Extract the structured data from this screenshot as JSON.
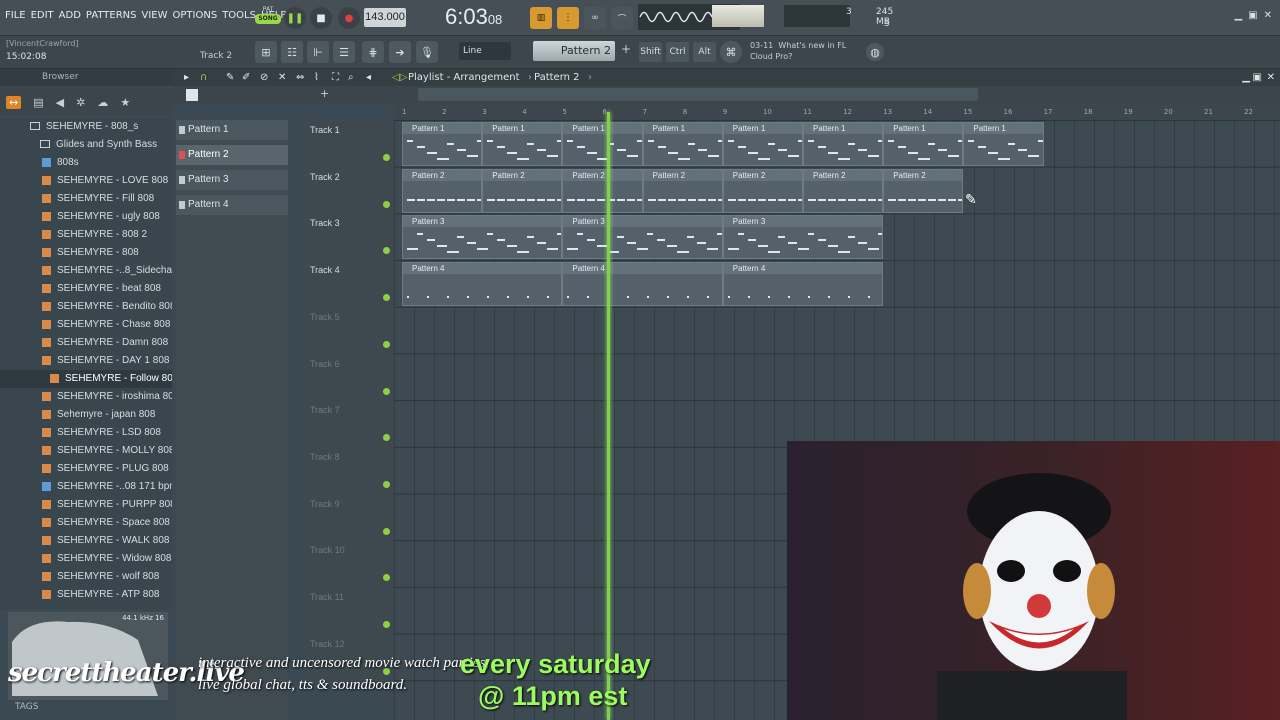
{
  "menu": [
    "FILE",
    "EDIT",
    "ADD",
    "PATTERNS",
    "VIEW",
    "OPTIONS",
    "TOOLS",
    "HELP"
  ],
  "transport": {
    "pat_label": "PAT",
    "song_label": "SONG",
    "tempo": "143.000",
    "time_main": "6:03",
    "time_sub": "08",
    "mem": "245 MB",
    "cpu_voices": "3",
    "poly": "5",
    "rec_icon": "record-icon",
    "play_icon": "pause-icon",
    "stop_icon": "stop-icon"
  },
  "toolbar2": {
    "hint_user": "[VincentCrawford]",
    "hint_time": "15:02:08",
    "hint_track": "Track 2",
    "snap": "Line",
    "pattern_selector": "Pattern 2",
    "shift": "Shift",
    "ctrl": "Ctrl",
    "alt": "Alt",
    "news_date": "03-11",
    "news_line1": "What's new in FL",
    "news_line2": "Cloud Pro?"
  },
  "browser": {
    "title": "Browser",
    "tags_label": "TAGS",
    "preview_info": "44.1 kHz 16",
    "items": [
      {
        "label": "SEHEMYRE - 808_s",
        "kind": "folder"
      },
      {
        "label": "Glides and Synth Bass",
        "kind": "folder"
      },
      {
        "label": "808s",
        "kind": "blue"
      },
      {
        "label": "SEHEMYRE -  LOVE 808",
        "kind": "file"
      },
      {
        "label": "SEHEMYRE - Fill 808",
        "kind": "file"
      },
      {
        "label": "SEHEMYRE - ugly 808",
        "kind": "file"
      },
      {
        "label": "SEHEMYRE - 808 2",
        "kind": "file"
      },
      {
        "label": "SEHEMYRE - 808",
        "kind": "file"
      },
      {
        "label": "SEHEMYRE -..8_Sidechain",
        "kind": "file"
      },
      {
        "label": "SEHEMYRE - beat 808",
        "kind": "file"
      },
      {
        "label": "SEHEMYRE - Bendito 808",
        "kind": "file"
      },
      {
        "label": "SEHEMYRE - Chase 808",
        "kind": "file"
      },
      {
        "label": "SEHEMYRE - Damn 808",
        "kind": "file"
      },
      {
        "label": "SEHEMYRE - DAY 1 808",
        "kind": "file"
      },
      {
        "label": "SEHEMYRE - Follow 808",
        "kind": "file",
        "selected": true
      },
      {
        "label": "SEHEMYRE - iroshima 808",
        "kind": "file"
      },
      {
        "label": "Sehemyre - japan 808",
        "kind": "file"
      },
      {
        "label": "SEHEMYRE - LSD 808",
        "kind": "file"
      },
      {
        "label": "SEHEMYRE - MOLLY 808",
        "kind": "file"
      },
      {
        "label": "SEHEMYRE - PLUG 808",
        "kind": "file"
      },
      {
        "label": "SEHEMYRE -..08 171 bpm",
        "kind": "blue"
      },
      {
        "label": "SEHEMYRE - PURPP 808",
        "kind": "file"
      },
      {
        "label": "SEHEMYRE - Space 808",
        "kind": "file"
      },
      {
        "label": "SEHEMYRE - WALK 808",
        "kind": "file"
      },
      {
        "label": "SEHEMYRE - Widow 808",
        "kind": "file"
      },
      {
        "label": "SEHEMYRE - wolf 808",
        "kind": "file"
      },
      {
        "label": "SEHEMYRE - ATP 808",
        "kind": "file"
      }
    ]
  },
  "playlist": {
    "title": "Playlist - Arrangement",
    "current_pattern": "Pattern 2",
    "patterns": [
      "Pattern 1",
      "Pattern 2",
      "Pattern 3",
      "Pattern 4"
    ],
    "selected_pattern": 1,
    "tracks": [
      "Track 1",
      "Track 2",
      "Track 3",
      "Track 4",
      "Track 5",
      "Track 6",
      "Track 7",
      "Track 8",
      "Track 9",
      "Track 10",
      "Track 11",
      "Track 12"
    ],
    "ruler": [
      "1",
      "2",
      "3",
      "4",
      "5",
      "6",
      "7",
      "8",
      "9",
      "10",
      "11",
      "12",
      "13",
      "14",
      "15",
      "16",
      "17",
      "18",
      "19",
      "20",
      "21",
      "22"
    ],
    "clips": [
      {
        "track": 0,
        "label": "Pattern 1",
        "starts": [
          1,
          3,
          5,
          7,
          9,
          11,
          13,
          15
        ],
        "len": 2
      },
      {
        "track": 1,
        "label": "Pattern 2",
        "starts": [
          1,
          3,
          5,
          7,
          9,
          11,
          13
        ],
        "len": 2
      },
      {
        "track": 2,
        "label": "Pattern 3",
        "starts": [
          1,
          5,
          9
        ],
        "len": 4
      },
      {
        "track": 3,
        "label": "Pattern 4",
        "starts": [
          1,
          5,
          9
        ],
        "len": 4
      }
    ],
    "playhead_bar": 6.1
  },
  "overlay": {
    "brand": "secrettheater.live",
    "tagline1": "interactive and uncensored movie watch parties,",
    "tagline2": "live global chat, tts & soundboard.",
    "schedule1": "every saturday",
    "schedule2": "@ 11pm est"
  },
  "colors": {
    "playhead": "#7fd24a",
    "song_mode": "#9ad84a",
    "accent": "#d89a30"
  }
}
